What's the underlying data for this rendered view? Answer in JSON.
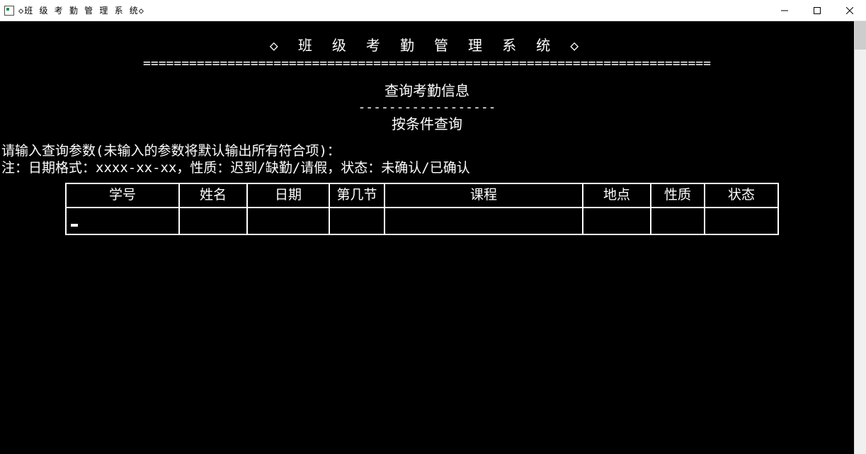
{
  "window": {
    "title": "◇班 级 考 勤 管 理 系 统◇"
  },
  "banner": {
    "title": "◇ 班 级 考 勤 管 理 系 统 ◇",
    "line": "=========================================================================="
  },
  "section": {
    "title": "查询考勤信息",
    "divider": "------------------",
    "subtitle": "按条件查询"
  },
  "prompt": {
    "line1": "请输入查询参数(未输入的参数将默认输出所有符合项)：",
    "line2": "注：日期格式：xxxx-xx-xx，性质：迟到/缺勤/请假，状态：未确认/已确认"
  },
  "table": {
    "headers": {
      "id": "学号",
      "name": "姓名",
      "date": "日期",
      "period": "第几节",
      "course": "课程",
      "place": "地点",
      "nature": "性质",
      "status": "状态"
    },
    "input_row": {
      "id": "",
      "name": "",
      "date": "",
      "period": "",
      "course": "",
      "place": "",
      "nature": "",
      "status": ""
    }
  }
}
